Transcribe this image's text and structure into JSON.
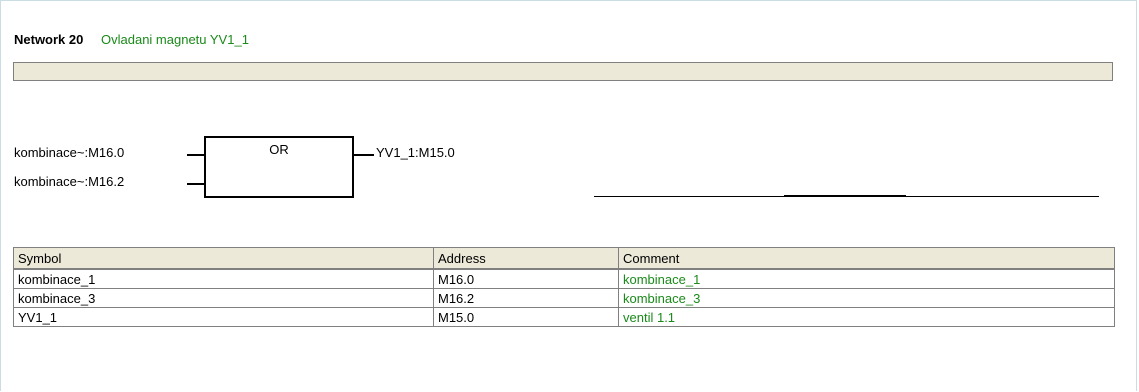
{
  "network": {
    "title": "Network 20",
    "comment": "Ovladani magnetu YV1_1"
  },
  "block": {
    "type": "OR",
    "inputs": [
      "kombinace~:M16.0",
      "kombinace~:M16.2"
    ],
    "output": "YV1_1:M15.0"
  },
  "table": {
    "headers": [
      "Symbol",
      "Address",
      "Comment"
    ],
    "rows": [
      {
        "symbol": "kombinace_1",
        "address": "M16.0",
        "comment": "kombinace_1"
      },
      {
        "symbol": "kombinace_3",
        "address": "M16.2",
        "comment": "kombinace_3"
      },
      {
        "symbol": "YV1_1",
        "address": "M15.0",
        "comment": "ventil 1.1"
      }
    ]
  },
  "colors": {
    "comment_green": "#1a8a1a",
    "header_bg": "#ece9d8"
  }
}
